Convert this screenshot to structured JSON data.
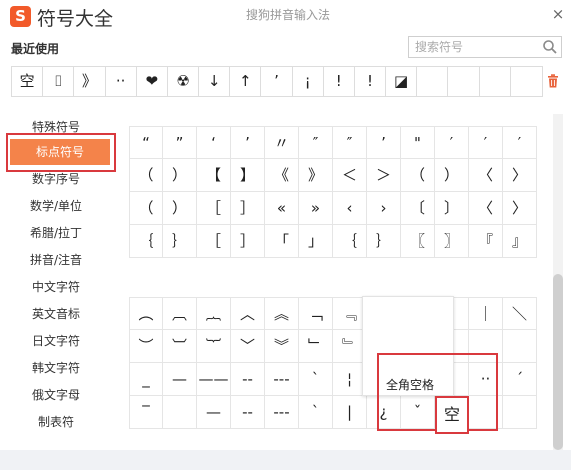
{
  "window": {
    "logo": "S",
    "title": "符号大全",
    "subtitle": "搜狗拼音输入法",
    "close": "×"
  },
  "recent": {
    "label": "最近使用",
    "symbols": [
      "空",
      "⌷",
      "》",
      "··",
      "❤",
      "☢",
      "↓",
      "↑",
      "’",
      "¡",
      "!",
      "!",
      "◪",
      "",
      "",
      "",
      ""
    ]
  },
  "search": {
    "placeholder": "搜索符号"
  },
  "sidebar": {
    "items": [
      "特殊符号",
      "标点符号",
      "数字序号",
      "数学/单位",
      "希腊/拉丁",
      "拼音/注音",
      "中文字符",
      "英文音标",
      "日文字符",
      "韩文字符",
      "俄文字母",
      "制表符"
    ],
    "active_index": 1
  },
  "grid_top": [
    [
      "“",
      "”",
      "‘",
      "’",
      "〃",
      "″",
      "″",
      "’",
      "\"",
      "′",
      "′",
      "′"
    ],
    [
      "（",
      "）",
      "【",
      "】",
      "《",
      "》",
      "＜",
      "＞",
      "（",
      "）",
      "〈",
      "〉"
    ],
    [
      "（",
      "）",
      "［",
      "］",
      "«",
      "»",
      "‹",
      "›",
      "〔",
      "〕",
      "〈",
      "〉"
    ],
    [
      "｛",
      "｝",
      "［",
      "］",
      "「",
      "」",
      "｛",
      "｝",
      "〖",
      "〗",
      "『",
      "』"
    ]
  ],
  "grid_bottom": [
    [
      "︵",
      "︹",
      "︷",
      "︿",
      "︽",
      "﹁",
      "﹃",
      "",
      "",
      "/",
      "｜",
      "＼"
    ],
    [
      "︶",
      "︺",
      "︸",
      "﹀",
      "︾",
      "﹂",
      "﹄",
      "",
      "",
      "",
      "",
      ""
    ],
    [
      "_",
      "—",
      "——",
      "--",
      "---",
      "ˋ",
      "¦",
      "",
      "",
      "",
      "··",
      "ˊ"
    ],
    [
      "‾",
      "",
      "—",
      "--",
      "---",
      "ˋ",
      "|",
      "¿",
      "ˇ",
      "空",
      "",
      ""
    ]
  ],
  "tooltip": {
    "text": "全角空格"
  },
  "space_symbol": "空",
  "colors": {
    "accent": "#f4834a",
    "highlight": "#d9393e",
    "logo": "#f25a2a"
  }
}
